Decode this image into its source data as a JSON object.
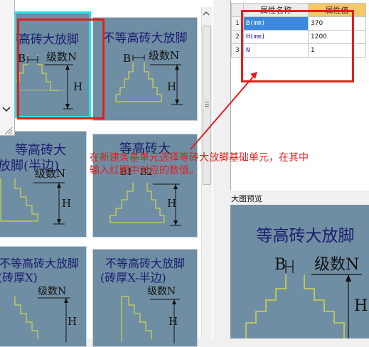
{
  "gallery": {
    "tiles": [
      {
        "title": "等高砖大放脚",
        "b": "B",
        "level": "级数N",
        "h": "H",
        "selected": true
      },
      {
        "title": "不等高砖大放脚",
        "b": "B",
        "level": "级数N",
        "h": "H",
        "selected": false
      },
      {
        "title": "等高砖大",
        "title2": "放脚(半边)",
        "level": "级数N",
        "h": "H"
      },
      {
        "title": "等高砖大",
        "b1": "B1",
        "b2": "B2",
        "h": "H"
      },
      {
        "title": "不等高砖大放脚",
        "title2": "(砖厚X)",
        "level": "级数N",
        "h": "H"
      },
      {
        "title": "不等高砖大放脚",
        "title2": "(砖厚X-半边)",
        "level": "级数N",
        "h": "H"
      }
    ]
  },
  "properties": {
    "headers": [
      "属性名称",
      "属性值"
    ],
    "rows": [
      {
        "num": "1",
        "name": "B(mm)",
        "value": "370"
      },
      {
        "num": "2",
        "name": "H(mm)",
        "value": "1200"
      },
      {
        "num": "3",
        "name": "N",
        "value": "1"
      }
    ]
  },
  "preview": {
    "label": "大图预览",
    "title": "等高砖大放脚",
    "b": "B",
    "level": "级数N",
    "h": "H"
  },
  "annotation": {
    "line1": "在新建条基单元选择等砖大放脚基础单元，在其中",
    "line2": "输入红图中对应的数值。"
  },
  "colors": {
    "tile_bg": "#6f8ea4",
    "annotation": "#e0201e",
    "highlight_header": "#f7c867",
    "selection": "#3b88dc",
    "tile_border_selected": "#23e3ea"
  }
}
